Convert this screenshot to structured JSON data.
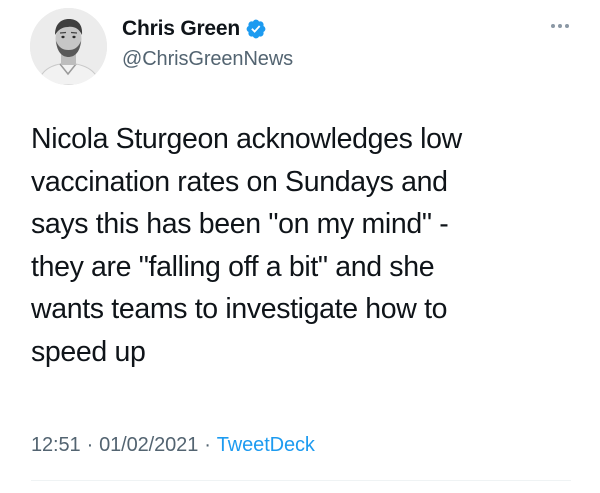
{
  "author": {
    "display_name": "Chris Green",
    "handle": "@ChrisGreenNews",
    "verified": true,
    "avatar_icon": "profile-photo"
  },
  "menu": {
    "icon": "more-horizontal-icon"
  },
  "tweet": {
    "text_lines": [
      "Nicola Sturgeon acknowledges low",
      "vaccination rates on Sundays and",
      "says this has been \"on my mind\" -",
      "they are \"falling off a bit\" and she",
      "wants teams to investigate how to",
      "speed up"
    ],
    "time": "12:51",
    "date": "01/02/2021",
    "separator": "·",
    "source": "TweetDeck"
  },
  "colors": {
    "text": "#0f1419",
    "secondary": "#536471",
    "link": "#1d9bf0",
    "verified": "#1d9bf0",
    "divider": "#eff3f4"
  }
}
